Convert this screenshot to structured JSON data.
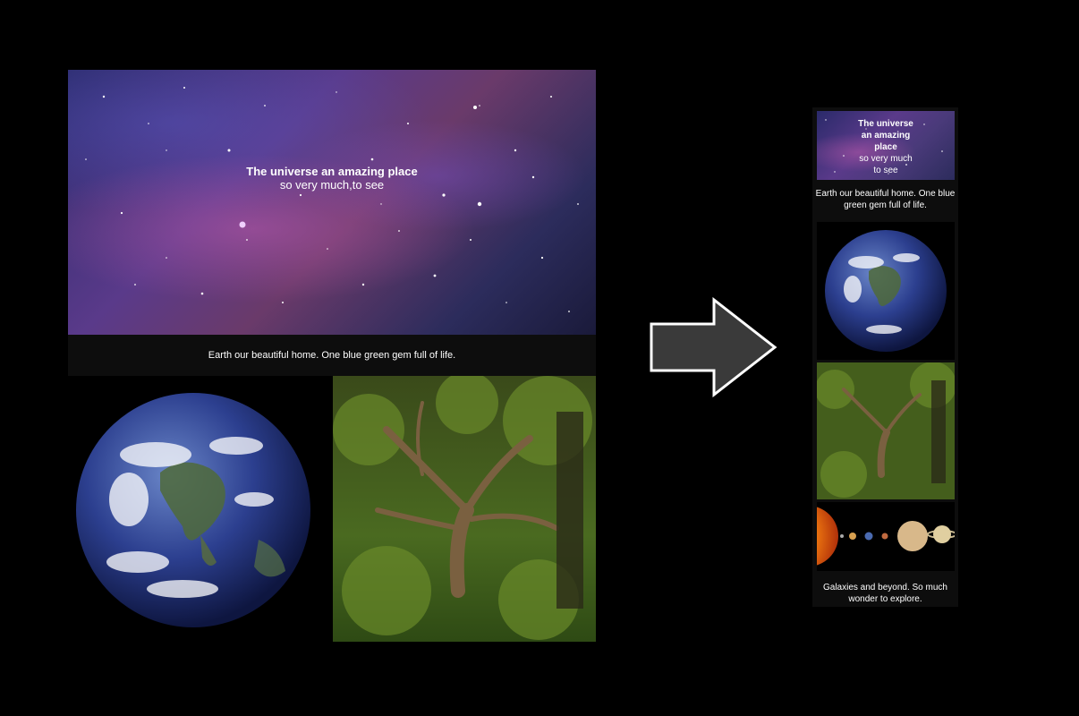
{
  "desktop": {
    "hero": {
      "title": "The universe an amazing place",
      "subtitle": "so very much,to see"
    },
    "caption": "Earth our beautiful home. One blue green gem full of life."
  },
  "mobile": {
    "hero": {
      "title_lines": [
        "The universe",
        "an amazing",
        "place"
      ],
      "subtitle_lines": [
        "so very much",
        "to see"
      ]
    },
    "caption_1": "Earth our beautiful home. One blue green gem full of life.",
    "caption_2": "Galaxies and beyond. So much wonder to explore."
  },
  "icons": {
    "arrow": "right-arrow-icon"
  },
  "colors": {
    "background": "#000000",
    "panel": "#0d0d0d",
    "arrow_fill": "#3a3a3a",
    "arrow_stroke": "#ffffff"
  }
}
